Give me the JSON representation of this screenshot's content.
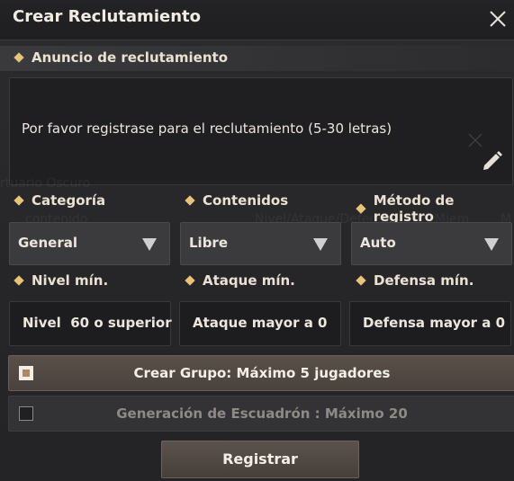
{
  "window": {
    "title": "Crear Reclutamiento"
  },
  "announcement": {
    "section_label": "Anuncio de reclutamiento",
    "placeholder": "Por favor registrase para el reclutamiento (5-30 letras)"
  },
  "background_ghost": {
    "text1": "rtuario Oscuro",
    "text2": "contenido",
    "text3": "Nivel/Ataque/Defensa",
    "text4": "Miem",
    "text5": "M"
  },
  "filters": {
    "category": {
      "label": "Categoría",
      "value": "General"
    },
    "content": {
      "label": "Contenidos",
      "value": "Libre"
    },
    "method": {
      "label": "Método de registro",
      "value": "Auto"
    }
  },
  "requirements": {
    "level": {
      "label": "Nivel mín.",
      "value": "Nivel  60 o superior"
    },
    "attack": {
      "label": "Ataque mín.",
      "value": "Ataque mayor a 0"
    },
    "defense": {
      "label": "Defensa mín.",
      "value": "Defensa mayor a 0"
    }
  },
  "options": {
    "group": {
      "label": "Crear Grupo: Máximo 5 jugadores",
      "checked": true
    },
    "squadron": {
      "label": "Generación de Escuadrón : Máximo 20",
      "checked": false
    }
  },
  "actions": {
    "register_label": "Registrar"
  },
  "colors": {
    "accent_diamond": "#e9c37a",
    "panel_bg": "#2a2a2c"
  }
}
